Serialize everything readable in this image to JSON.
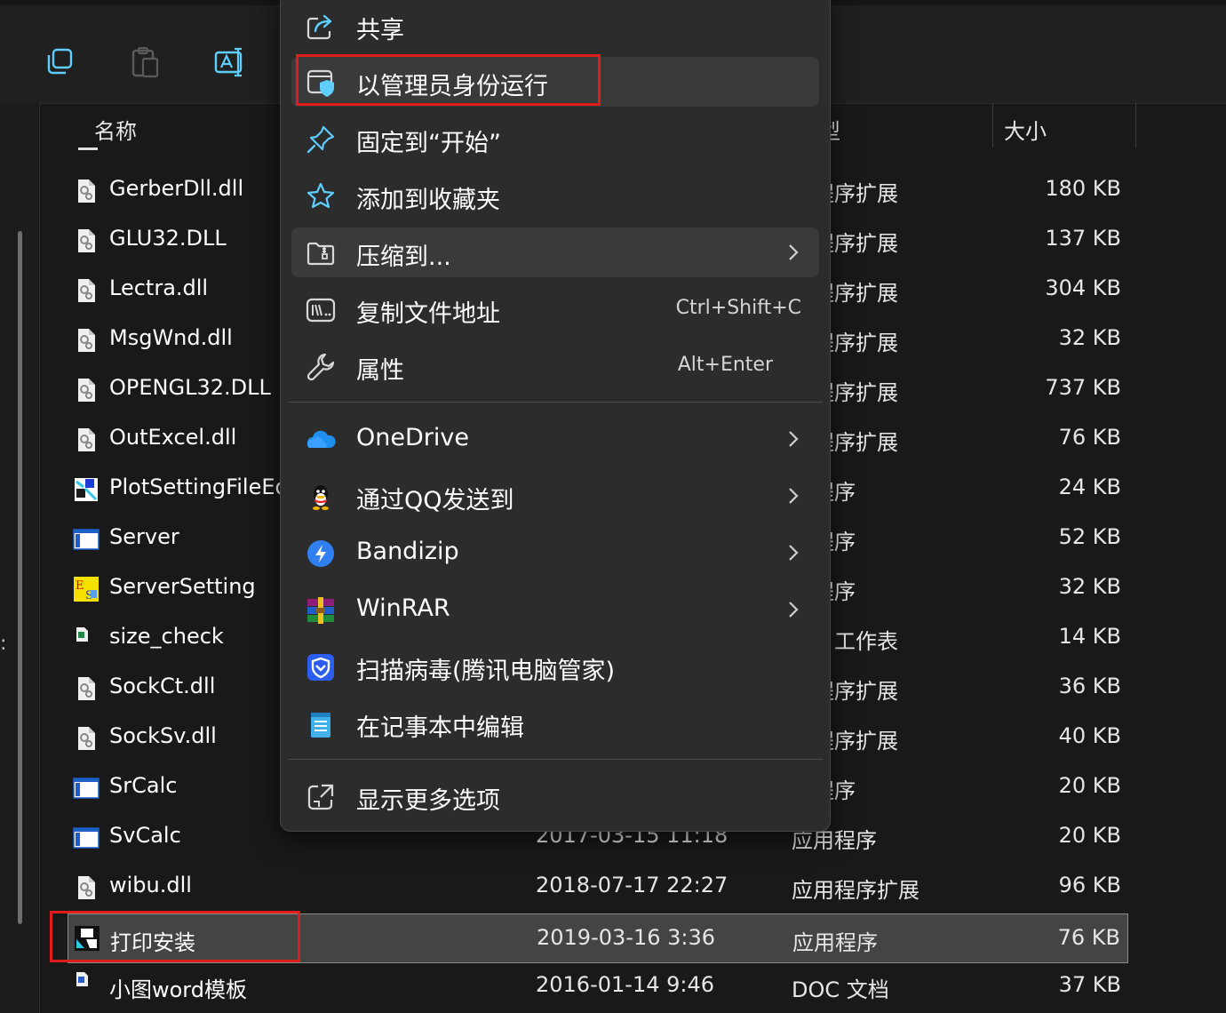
{
  "columns": {
    "name": "名称",
    "type_partial": "型",
    "size": "大小"
  },
  "files": [
    {
      "name": "GerberDll.dll",
      "type": "用程序扩展",
      "size": "180 KB",
      "icon": "dll-file-icon"
    },
    {
      "name": "GLU32.DLL",
      "type": "用程序扩展",
      "size": "137 KB",
      "icon": "dll-file-icon"
    },
    {
      "name": "Lectra.dll",
      "type": "用程序扩展",
      "size": "304 KB",
      "icon": "dll-file-icon"
    },
    {
      "name": "MsgWnd.dll",
      "type": "用程序扩展",
      "size": "32 KB",
      "icon": "dll-file-icon"
    },
    {
      "name": "OPENGL32.DLL",
      "type": "用程序扩展",
      "size": "737 KB",
      "icon": "dll-file-icon"
    },
    {
      "name": "OutExcel.dll",
      "type": "用程序扩展",
      "size": "76 KB",
      "icon": "dll-file-icon"
    },
    {
      "name": "PlotSettingFileEd",
      "type": "用程序",
      "size": "24 KB",
      "icon": "plot-app-icon"
    },
    {
      "name": "Server",
      "type": "用程序",
      "size": "52 KB",
      "icon": "window-app-icon"
    },
    {
      "name": "ServerSetting",
      "type": "用程序",
      "size": "32 KB",
      "icon": "es-app-icon"
    },
    {
      "name": "size_check",
      "type": "工作表",
      "size": "14 KB",
      "icon": "worksheet-file-icon"
    },
    {
      "name": "SockCt.dll",
      "type": "用程序扩展",
      "size": "36 KB",
      "icon": "dll-file-icon"
    },
    {
      "name": "SockSv.dll",
      "type": "用程序扩展",
      "size": "40 KB",
      "icon": "dll-file-icon"
    },
    {
      "name": "SrCalc",
      "type": "用程序",
      "size": "20 KB",
      "icon": "window-app-icon"
    },
    {
      "name": "SvCalc",
      "date": "2017-03-15 11:18",
      "type": "应用程序",
      "size": "20 KB",
      "icon": "window-app-icon"
    },
    {
      "name": "wibu.dll",
      "date": "2018-07-17 22:27",
      "type": "应用程序扩展",
      "size": "96 KB",
      "icon": "dll-file-icon"
    },
    {
      "name": "打印安装",
      "date": "2019-03-16 3:36",
      "type": "应用程序",
      "size": "76 KB",
      "icon": "print-install-icon",
      "selected": true
    },
    {
      "name": "小图word模板",
      "date": "2016-01-14 9:46",
      "type": "DOC 文档",
      "size": "37 KB",
      "icon": "word-doc-icon"
    }
  ],
  "menu": {
    "items": [
      {
        "label": "共享",
        "icon": "share-icon"
      },
      {
        "label": "以管理员身份运行",
        "icon": "admin-shield-icon"
      },
      {
        "label": "固定到“开始”",
        "icon": "pin-icon"
      },
      {
        "label": "添加到收藏夹",
        "icon": "star-icon"
      },
      {
        "label": "压缩到...",
        "icon": "zip-folder-icon"
      },
      {
        "label": "复制文件地址",
        "shortcut": "Ctrl+Shift+C",
        "icon": "copy-path-icon"
      },
      {
        "label": "属性",
        "shortcut": "Alt+Enter",
        "icon": "wrench-icon"
      },
      {
        "label": "OneDrive",
        "icon": "onedrive-icon"
      },
      {
        "label": "通过QQ发送到",
        "icon": "qq-icon"
      },
      {
        "label": "Bandizip",
        "icon": "bandizip-icon"
      },
      {
        "label": "WinRAR",
        "icon": "winrar-icon"
      },
      {
        "label": "扫描病毒(腾讯电脑管家)",
        "icon": "tencent-shield-icon"
      },
      {
        "label": "在记事本中编辑",
        "icon": "notepad-icon"
      },
      {
        "label": "显示更多选项",
        "icon": "more-options-icon"
      }
    ]
  },
  "colors": {
    "highlight": "#e01c1c",
    "background": "#191919",
    "menu_bg": "#2c2c2c",
    "accent": "#60cdff"
  }
}
